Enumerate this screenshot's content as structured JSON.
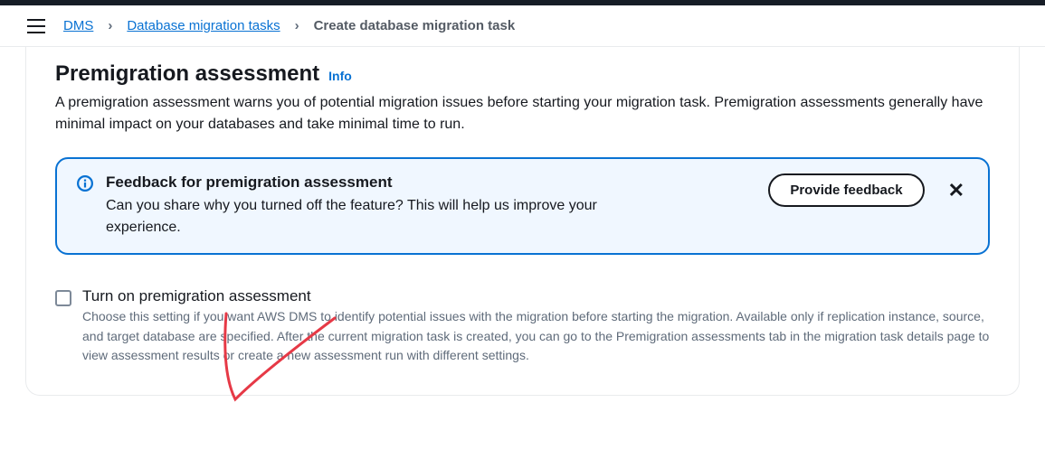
{
  "breadcrumb": {
    "items": [
      {
        "label": "DMS"
      },
      {
        "label": "Database migration tasks"
      }
    ],
    "current": "Create database migration task"
  },
  "section": {
    "title": "Premigration assessment",
    "info_label": "Info",
    "description": "A premigration assessment warns you of potential migration issues before starting your migration task. Premigration assessments generally have minimal impact on your databases and take minimal time to run."
  },
  "alert": {
    "title": "Feedback for premigration assessment",
    "text": "Can you share why you turned off the feature? This will help us improve your experience.",
    "button_label": "Provide feedback"
  },
  "checkbox": {
    "label": "Turn on premigration assessment",
    "description": "Choose this setting if you want AWS DMS to identify potential issues with the migration before starting the migration. Available only if replication instance, source, and target database are specified. After the current migration task is created, you can go to the Premigration assessments tab in the migration task details page to view assessment results or create a new assessment run with different settings."
  }
}
